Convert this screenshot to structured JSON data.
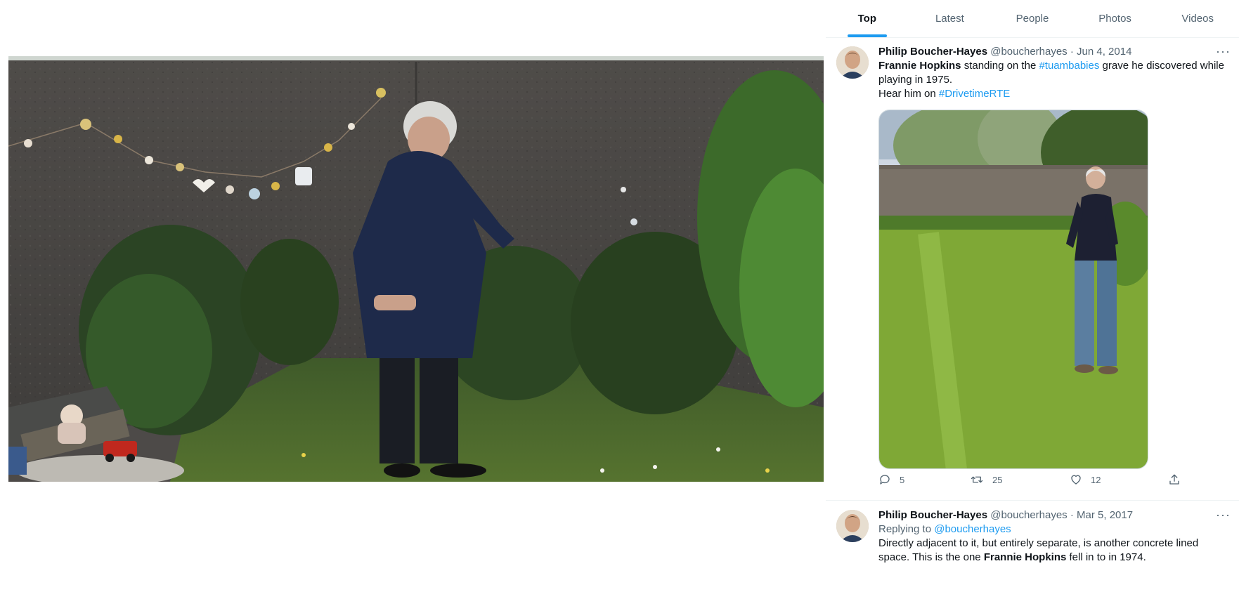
{
  "tabs": [
    {
      "label": "Top",
      "active": true
    },
    {
      "label": "Latest",
      "active": false
    },
    {
      "label": "People",
      "active": false
    },
    {
      "label": "Photos",
      "active": false
    },
    {
      "label": "Videos",
      "active": false
    }
  ],
  "tweets": [
    {
      "author": {
        "name": "Philip Boucher-Hayes",
        "handle": "@boucherhayes"
      },
      "date": "Jun 4, 2014",
      "text": {
        "line1_bold": "Frannie Hopkins",
        "line1_a": " standing on the ",
        "hashtag1": "#tuambabies",
        "line1_b": " grave he discovered while playing in 1975.",
        "line2_a": "Hear him on ",
        "hashtag2": "#DrivetimeRTE"
      },
      "stats": {
        "replies": "5",
        "retweets": "25",
        "likes": "12"
      }
    },
    {
      "author": {
        "name": "Philip Boucher-Hayes",
        "handle": "@boucherhayes"
      },
      "date": "Mar 5, 2017",
      "replying_label": "Replying to ",
      "replying_handle": "@boucherhayes",
      "text": {
        "part_a": "Directly adjacent to it, but entirely separate, is another concrete lined space. This is the one ",
        "bold": "Frannie Hopkins",
        "part_b": " fell in to in 1974."
      }
    }
  ],
  "separator": " · ",
  "more_glyph": "···",
  "icons": {
    "reply": "reply-icon",
    "retweet": "retweet-icon",
    "like": "heart-icon",
    "share": "share-icon",
    "more": "more-icon"
  },
  "colors": {
    "accent": "#1d9bf0",
    "secondary_text": "#536471",
    "primary_text": "#0f1419",
    "divider": "#eff3f4"
  }
}
